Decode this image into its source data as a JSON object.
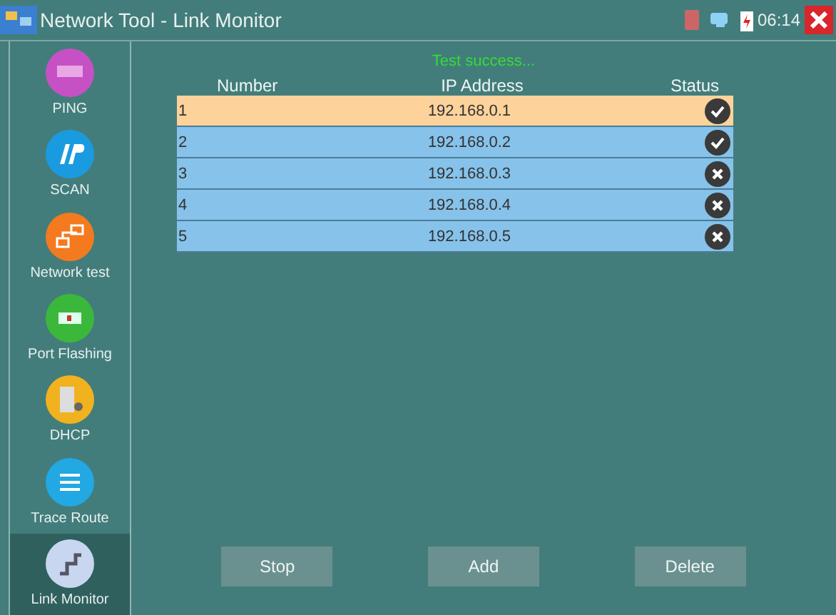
{
  "window": {
    "title": "Network Tool - Link Monitor",
    "clock": "06:14"
  },
  "sidebar": {
    "items": [
      {
        "label": "PING",
        "kind": "ping",
        "selected": false
      },
      {
        "label": "SCAN",
        "kind": "scan",
        "selected": false
      },
      {
        "label": "Network test",
        "kind": "network",
        "selected": false
      },
      {
        "label": "Port Flashing",
        "kind": "port",
        "selected": false
      },
      {
        "label": "DHCP",
        "kind": "dhcp",
        "selected": false
      },
      {
        "label": "Trace Route",
        "kind": "trace",
        "selected": false
      },
      {
        "label": "Link Monitor",
        "kind": "link",
        "selected": true
      }
    ]
  },
  "status_message": "Test success...",
  "table": {
    "columns": [
      "Number",
      "IP Address",
      "Status"
    ],
    "rows": [
      {
        "number": "1",
        "ip": "192.168.0.1",
        "passed": true,
        "selected": true
      },
      {
        "number": "2",
        "ip": "192.168.0.2",
        "passed": true,
        "selected": false
      },
      {
        "number": "3",
        "ip": "192.168.0.3",
        "passed": false,
        "selected": false
      },
      {
        "number": "4",
        "ip": "192.168.0.4",
        "passed": false,
        "selected": false
      },
      {
        "number": "5",
        "ip": "192.168.0.5",
        "passed": false,
        "selected": false
      }
    ]
  },
  "buttons": [
    "Stop",
    "Add",
    "Delete"
  ]
}
